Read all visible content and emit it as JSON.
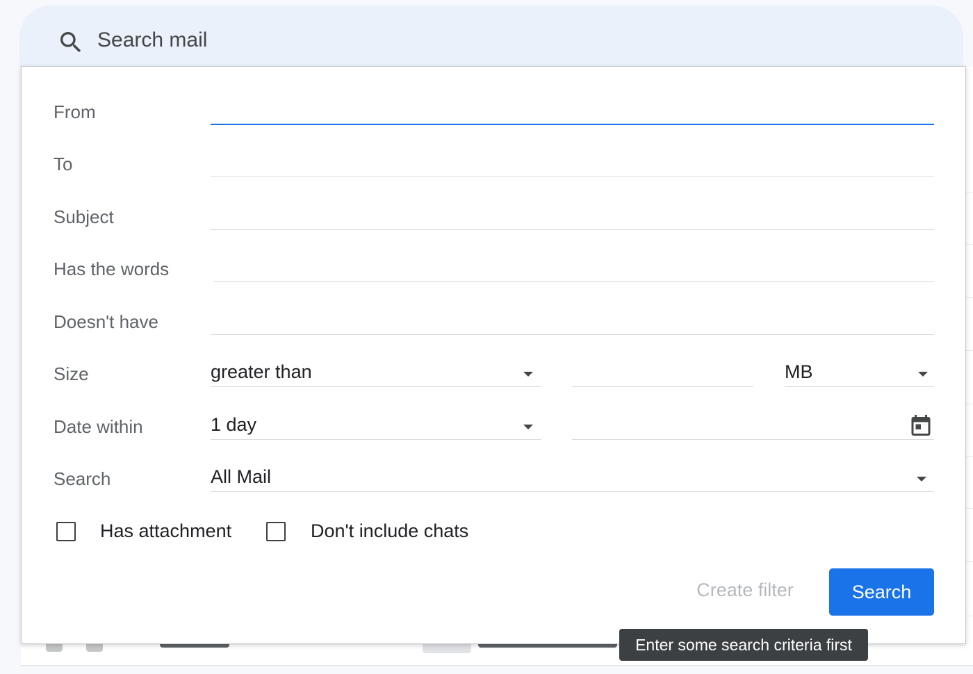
{
  "search": {
    "placeholder": "Search mail"
  },
  "form": {
    "from_label": "From",
    "to_label": "To",
    "subject_label": "Subject",
    "has_words_label": "Has the words",
    "doesnt_have_label": "Doesn't have",
    "size_label": "Size",
    "size_operator": "greater than",
    "size_unit": "MB",
    "date_label": "Date within",
    "date_value": "1 day",
    "search_label": "Search",
    "search_scope": "All Mail",
    "has_attachment_label": "Has attachment",
    "no_chats_label": "Don't include chats"
  },
  "buttons": {
    "create_filter": "Create filter",
    "search": "Search"
  },
  "tooltip": "Enter some search criteria first",
  "colors": {
    "accent": "#1a73e8",
    "search_bar_bg": "#eaf1fb",
    "tooltip_bg": "#3c4043"
  },
  "icons": {
    "search": "search-icon",
    "calendar": "calendar-icon",
    "dropdown": "chevron-down-icon"
  }
}
